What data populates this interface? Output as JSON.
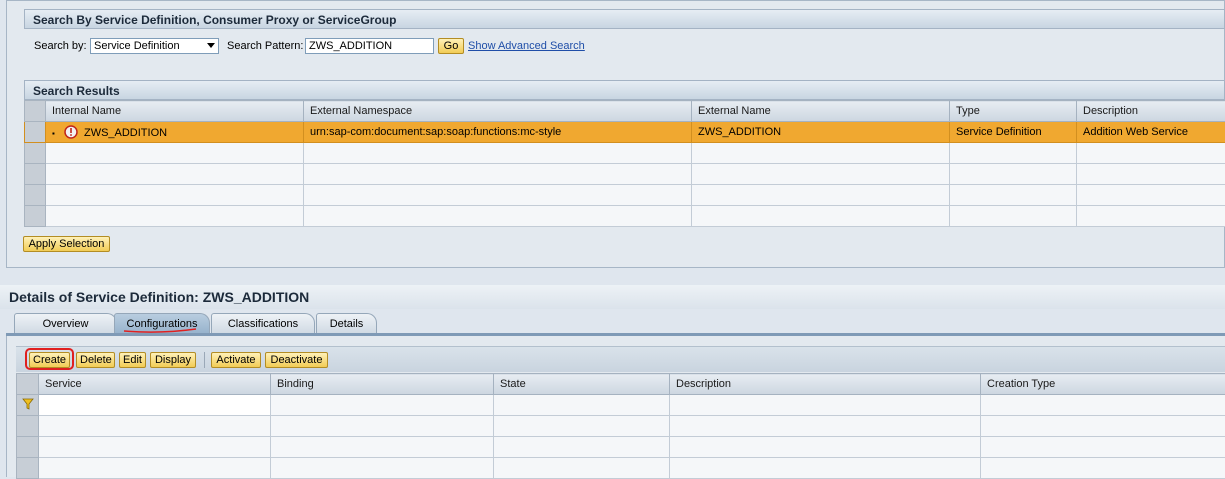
{
  "search": {
    "header": "Search By Service Definition, Consumer Proxy or ServiceGroup",
    "search_by_label": "Search by:",
    "search_by_value": "Service Definition",
    "pattern_label": "Search Pattern:",
    "pattern_value": "ZWS_ADDITION",
    "go_label": "Go",
    "advanced_link": "Show Advanced Search"
  },
  "results": {
    "header": "Search Results",
    "columns": [
      "Internal Name",
      "External Namespace",
      "External Name",
      "Type",
      "Description"
    ],
    "rows": [
      {
        "internal_name": "ZWS_ADDITION",
        "external_namespace": "urn:sap-com:document:sap:soap:functions:mc-style",
        "external_name": "ZWS_ADDITION",
        "type": "Service Definition",
        "description": "Addition Web Service"
      }
    ],
    "apply_label": "Apply Selection"
  },
  "details": {
    "title": "Details of Service Definition: ZWS_ADDITION",
    "tabs": [
      "Overview",
      "Configurations",
      "Classifications",
      "Details"
    ],
    "active_tab": "Configurations",
    "toolbar": {
      "create": "Create",
      "delete": "Delete",
      "edit": "Edit",
      "display": "Display",
      "activate": "Activate",
      "deactivate": "Deactivate"
    },
    "columns": [
      "Service",
      "Binding",
      "State",
      "Description",
      "Creation Type"
    ]
  },
  "colors": {
    "selected_row": "#f0a830",
    "button": "#f2cc55",
    "highlight": "#e02020"
  },
  "icons": {
    "row_status": "error-icon",
    "filter": "filter-icon",
    "dropdown": "chevron-down-icon"
  }
}
